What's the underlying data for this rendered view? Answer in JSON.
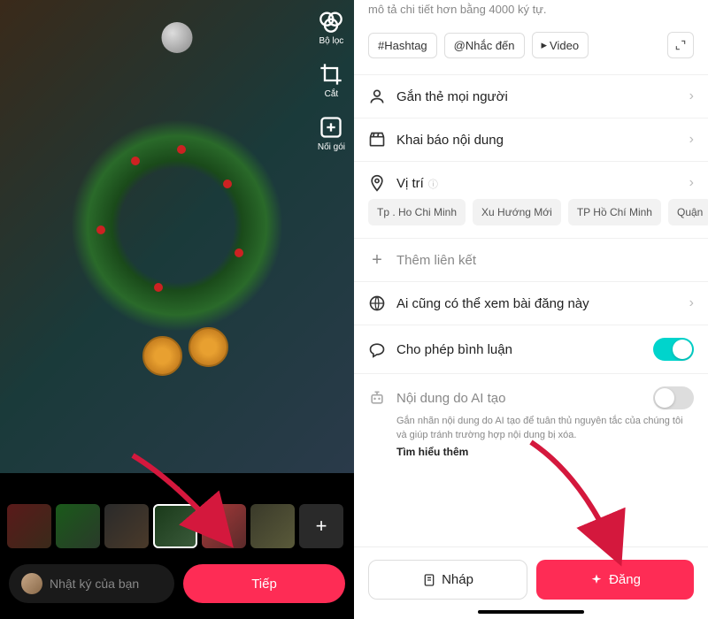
{
  "left": {
    "tools": {
      "filter": "Bộ lọc",
      "crop": "Cắt",
      "merge": "Nối gói"
    },
    "diary_placeholder": "Nhật ký của bạn",
    "next_label": "Tiếp"
  },
  "right": {
    "description_hint": "mô tả chi tiết hơn bằng 4000 ký tự.",
    "chips": {
      "hashtag": "#Hashtag",
      "mention": "@Nhắc đến",
      "video": "Video"
    },
    "options": {
      "tag_people": "Gắn thẻ mọi người",
      "disclose": "Khai báo nội dung",
      "location": "Vị trí",
      "add_link": "Thêm liên kết",
      "visibility": "Ai cũng có thể xem bài đăng này",
      "comments": "Cho phép bình luận",
      "ai_content": "Nội dung do AI tạo"
    },
    "location_suggestions": [
      "Tp . Ho Chi Minh",
      "Xu Hướng Mới",
      "TP Hồ Chí Minh",
      "Quận"
    ],
    "ai_desc": "Gắn nhãn nội dung do AI tạo để tuân thủ nguyên tắc của chúng tôi và giúp tránh trường hợp nội dung bị xóa.",
    "learn_more": "Tìm hiểu thêm",
    "draft_label": "Nháp",
    "post_label": "Đăng"
  },
  "colors": {
    "accent": "#fe2c55",
    "toggle_on": "#00d4cc"
  }
}
